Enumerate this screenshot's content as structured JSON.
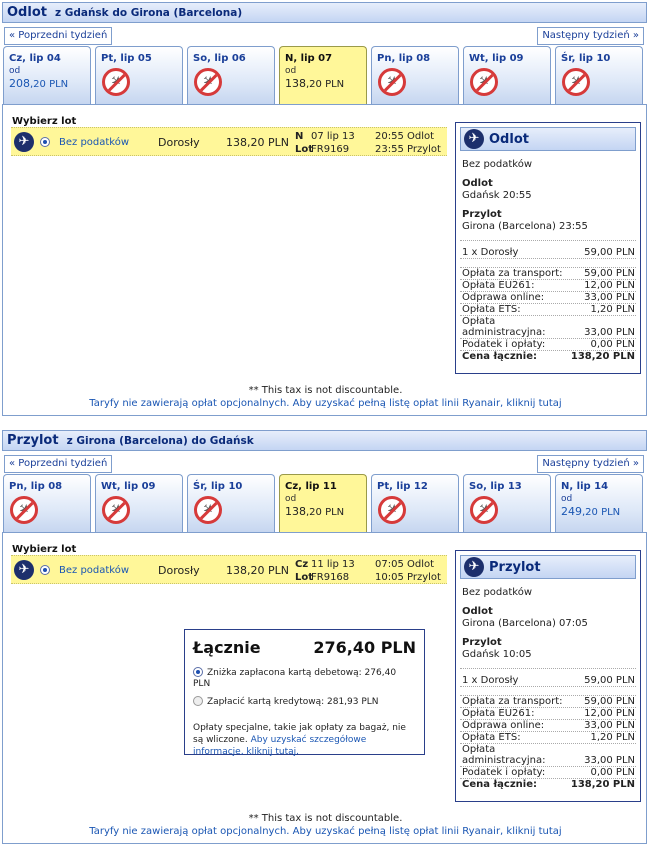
{
  "outbound": {
    "title": "Odlot",
    "subtitle": "z Gdańsk do Girona (Barcelona)",
    "prev_week": "« Poprzedni tydzień",
    "next_week": "Następny tydzień »",
    "days": [
      {
        "label": "Cz, lip 04",
        "from": "od",
        "price_int": "208",
        "price_dec": ",20 PLN",
        "available": true,
        "selected": false
      },
      {
        "label": "Pt, lip 05",
        "available": false,
        "selected": false
      },
      {
        "label": "So, lip 06",
        "available": false,
        "selected": false
      },
      {
        "label": "N, lip 07",
        "from": "od",
        "price_int": "138",
        "price_dec": ",20 PLN",
        "available": true,
        "selected": true
      },
      {
        "label": "Pn, lip 08",
        "available": false,
        "selected": false
      },
      {
        "label": "Wt, lip 09",
        "available": false,
        "selected": false
      },
      {
        "label": "Śr, lip 10",
        "available": false,
        "selected": false
      }
    ],
    "choose_label": "Wybierz lot",
    "flight": {
      "fare": "Bez podatków",
      "pax": "Dorosły",
      "price": "138,20 PLN",
      "day_code": "N",
      "date": "07 lip 13",
      "flight_label": "Lot",
      "flight_no": "FR9169",
      "dep_time": "20:55",
      "dep_label": "Odlot",
      "arr_time": "23:55",
      "arr_label": "Przylot"
    },
    "summary": {
      "title": "Odlot",
      "fare": "Bez podatków",
      "dep_label": "Odlot",
      "dep_value": "Gdańsk 20:55",
      "arr_label": "Przylot",
      "arr_value": "Girona (Barcelona) 23:55",
      "pax_label": "1 x Dorosły",
      "pax_value": "59,00 PLN",
      "fees": [
        {
          "label": "Opłata za transport:",
          "value": "59,00 PLN"
        },
        {
          "label": "Opłata EU261:",
          "value": "12,00 PLN"
        },
        {
          "label": "Odprawa online:",
          "value": "33,00 PLN"
        },
        {
          "label": "Opłata ETS:",
          "value": "1,20 PLN"
        },
        {
          "label": "Opłata administracyjna:",
          "value": "33,00 PLN"
        },
        {
          "label": "Podatek i opłaty:",
          "value": "0,00 PLN"
        }
      ],
      "total_label": "Cena łącznie:",
      "total_value": "138,20 PLN"
    },
    "note_tax": "** This tax is not discountable.",
    "note_link": "Taryfy nie zawierają opłat opcjonalnych. Aby uzyskać pełną listę opłat linii Ryanair, kliknij tutaj"
  },
  "return": {
    "title": "Przylot",
    "subtitle": "z Girona (Barcelona) do Gdańsk",
    "prev_week": "« Poprzedni tydzień",
    "next_week": "Następny tydzień »",
    "days": [
      {
        "label": "Pn, lip 08",
        "available": false,
        "selected": false
      },
      {
        "label": "Wt, lip 09",
        "available": false,
        "selected": false
      },
      {
        "label": "Śr, lip 10",
        "available": false,
        "selected": false
      },
      {
        "label": "Cz, lip 11",
        "from": "od",
        "price_int": "138",
        "price_dec": ",20 PLN",
        "available": true,
        "selected": true
      },
      {
        "label": "Pt, lip 12",
        "available": false,
        "selected": false
      },
      {
        "label": "So, lip 13",
        "available": false,
        "selected": false
      },
      {
        "label": "N, lip 14",
        "from": "od",
        "price_int": "249",
        "price_dec": ",20 PLN",
        "available": true,
        "selected": false
      }
    ],
    "choose_label": "Wybierz lot",
    "flight": {
      "fare": "Bez podatków",
      "pax": "Dorosły",
      "price": "138,20 PLN",
      "day_code": "Cz",
      "date": "11 lip 13",
      "flight_label": "Lot",
      "flight_no": "FR9168",
      "dep_time": "07:05",
      "dep_label": "Odlot",
      "arr_time": "10:05",
      "arr_label": "Przylot"
    },
    "summary": {
      "title": "Przylot",
      "fare": "Bez podatków",
      "dep_label": "Odlot",
      "dep_value": "Girona (Barcelona) 07:05",
      "arr_label": "Przylot",
      "arr_value": "Gdańsk 10:05",
      "pax_label": "1 x Dorosły",
      "pax_value": "59,00 PLN",
      "fees": [
        {
          "label": "Opłata za transport:",
          "value": "59,00 PLN"
        },
        {
          "label": "Opłata EU261:",
          "value": "12,00 PLN"
        },
        {
          "label": "Odprawa online:",
          "value": "33,00 PLN"
        },
        {
          "label": "Opłata ETS:",
          "value": "1,20 PLN"
        },
        {
          "label": "Opłata administracyjna:",
          "value": "33,00 PLN"
        },
        {
          "label": "Podatek i opłaty:",
          "value": "0,00 PLN"
        }
      ],
      "total_label": "Cena łącznie:",
      "total_value": "138,20 PLN"
    },
    "note_tax": "** This tax is not discountable.",
    "note_link": "Taryfy nie zawierają opłat opcjonalnych. Aby uzyskać pełną listę opłat linii Ryanair, kliknij tutaj"
  },
  "total": {
    "label": "Łącznie",
    "value": "276,40 PLN",
    "debit_option": "Zniżka zapłacona kartą debetową: 276,40 PLN",
    "credit_option": "Zapłacić kartą kredytową: 281,93 PLN",
    "fees_text": "Opłaty specjalne, takie jak opłaty za bagaż, nie są wliczone.",
    "fees_link": "Aby uzyskać szczegółowe informacje, kliknij tutaj."
  },
  "colors": {
    "header_text": "#0a2a7a",
    "selected_day": "#fff799",
    "link": "#1a56b3",
    "no_flight": "#d63a3a"
  }
}
